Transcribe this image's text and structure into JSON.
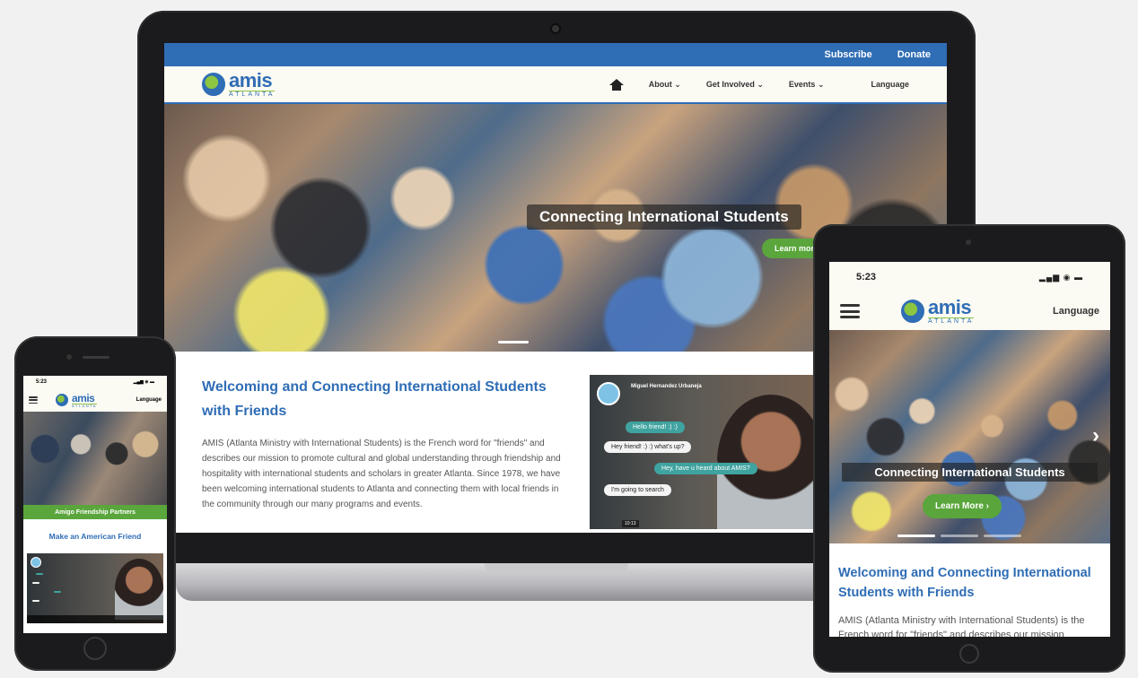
{
  "laptop": {
    "topbar": {
      "subscribe": "Subscribe",
      "donate": "Donate"
    },
    "logo": {
      "main": "amis",
      "sub": "ATLANTA"
    },
    "nav": {
      "about": "About",
      "get_involved": "Get Involved",
      "events": "Events",
      "language": "Language",
      "chevron": "⌄"
    },
    "hero": {
      "caption": "Connecting International Students",
      "button": "Learn more"
    },
    "section": {
      "heading": "Welcoming and Connecting International Students with Friends",
      "body": "AMIS (Atlanta Ministry with International Students) is the French word for \"friends\" and describes our mission to promote cultural and global understanding through friendship and hospitality with international students and scholars in greater Atlanta. Since 1978, we have been welcoming international students to Atlanta and connecting them with local friends in the community through our many programs and events."
    },
    "chat": {
      "name": "Miguel Hernandez Urbaneja",
      "messages": [
        {
          "text": "Hello friend! :) :)",
          "from": "them"
        },
        {
          "text": "Hey friend! :) :) what's up?",
          "from": "me"
        },
        {
          "text": "Hey, have u heard about AMIS?",
          "from": "them"
        },
        {
          "text": "I'm going to search",
          "from": "me"
        }
      ],
      "timestamp": "10:13"
    }
  },
  "tablet": {
    "time": "5:23",
    "signal": "▂▄▆ ◉ ▬",
    "logo": {
      "main": "amis",
      "sub": "ATLANTA"
    },
    "language": "Language",
    "hero": {
      "caption": "Connecting International Students",
      "button": "Learn More  ›"
    },
    "next_arrow": "›",
    "heading": "Welcoming and Connecting International Students with Friends",
    "body": "AMIS (Atlanta Ministry with International Students) is the French word for \"friends\" and describes our mission"
  },
  "phone": {
    "time": "5:23",
    "signal": "▂▄▆ ◉ ▬",
    "logo": {
      "main": "amis",
      "sub": "ATLANTA"
    },
    "language": "Language",
    "band": "Amigo Friendship Partners",
    "title": "Make an American Friend"
  },
  "colors": {
    "brand_blue": "#2f6db5",
    "brand_green": "#5aa63c",
    "nav_bg": "#fbfaf3"
  }
}
